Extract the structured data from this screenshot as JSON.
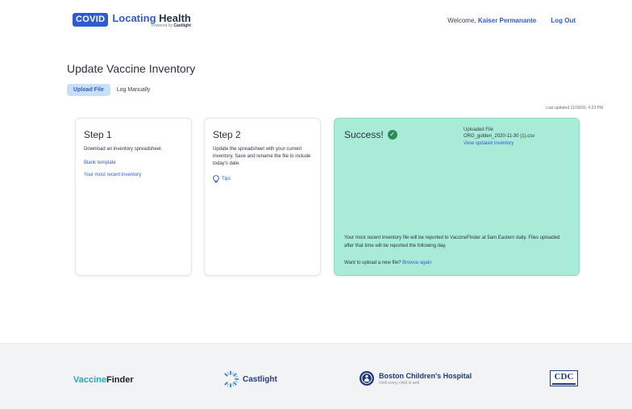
{
  "header": {
    "logo_badge": "COVID",
    "logo_name_1": "Locating",
    "logo_name_2": "Health",
    "logo_powered_prefix": "Powered by",
    "logo_powered_brand": "Castlight",
    "welcome_prefix": "Welcome,",
    "user_name": "Kaiser Permanante",
    "logout_label": "Log Out"
  },
  "page": {
    "title": "Update Vaccine Inventory",
    "tabs": [
      {
        "label": "Upload File",
        "active": true
      },
      {
        "label": "Log Manually",
        "active": false
      }
    ],
    "last_updated": "Last updated 11/30/20, 4:23 PM"
  },
  "step1": {
    "title": "Step 1",
    "text": "Download an inventory spreadsheet.",
    "link_blank": "Blank template",
    "link_recent": "Your most recent inventory"
  },
  "step2": {
    "title": "Step 2",
    "text": "Update the spreadsheet with your current inventory. Save and rename the file to include today's date.",
    "tips_label": "Tips"
  },
  "success": {
    "title": "Success!",
    "uploaded_label": "Uploaded File",
    "file_name": "ORG_golden_2020-11-30 (1).csv",
    "view_link": "View updated inventory",
    "note": "Your most recent inventory file will be reported to VaccineFinder at 5am Eastern daily. Files uploaded after that time will be reported the following day.",
    "again_prompt": "Want to upload a new file?",
    "browse_label": "Browse again"
  },
  "footer": {
    "vf_part1": "Vaccine",
    "vf_part2": "Finder",
    "castlight": "Castlight",
    "bch_name": "Boston Children's Hospital",
    "bch_tagline": "Until every child is well",
    "cdc": "CDC"
  },
  "colors": {
    "brand_blue": "#2f5bd0",
    "success_bg": "#a8ecd8",
    "tab_active_bg": "#c7e0f8",
    "footer_bg": "#f2f3f5"
  },
  "icons": {
    "success": "check-circle-icon",
    "tips": "lightbulb-icon",
    "castlight": "castlight-logo-icon",
    "bch": "bch-seal-icon"
  }
}
